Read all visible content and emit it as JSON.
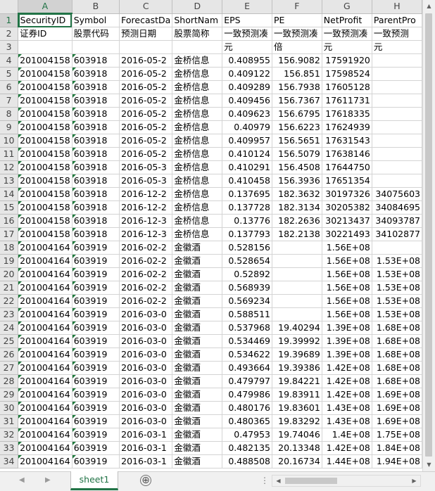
{
  "columns": [
    "A",
    "B",
    "C",
    "D",
    "E",
    "F",
    "G",
    "H"
  ],
  "active_column": "A",
  "active_row": 1,
  "rows": [
    {
      "n": "1",
      "cells": [
        "SecurityID",
        "Symbol",
        "ForecastDa",
        "ShortNam",
        "EPS",
        "PE",
        "NetProfit",
        "ParentPro"
      ]
    },
    {
      "n": "2",
      "cells": [
        "证券ID",
        "股票代码",
        "预测日期",
        "股票简称",
        "一致预测凑",
        "一致预测凑",
        "一致预测凑",
        "一致预测"
      ]
    },
    {
      "n": "3",
      "cells": [
        "",
        "",
        "",
        "",
        "元",
        "倍",
        "元",
        "元"
      ]
    },
    {
      "n": "4",
      "cells": [
        "201004158",
        "603918",
        "2016-05-2",
        "金桥信息",
        "0.408955",
        "156.9082",
        "17591920",
        ""
      ]
    },
    {
      "n": "5",
      "cells": [
        "201004158",
        "603918",
        "2016-05-2",
        "金桥信息",
        "0.409122",
        "156.851",
        "17598524",
        ""
      ]
    },
    {
      "n": "6",
      "cells": [
        "201004158",
        "603918",
        "2016-05-2",
        "金桥信息",
        "0.409289",
        "156.7938",
        "17605128",
        ""
      ]
    },
    {
      "n": "7",
      "cells": [
        "201004158",
        "603918",
        "2016-05-2",
        "金桥信息",
        "0.409456",
        "156.7367",
        "17611731",
        ""
      ]
    },
    {
      "n": "8",
      "cells": [
        "201004158",
        "603918",
        "2016-05-2",
        "金桥信息",
        "0.409623",
        "156.6795",
        "17618335",
        ""
      ]
    },
    {
      "n": "9",
      "cells": [
        "201004158",
        "603918",
        "2016-05-2",
        "金桥信息",
        "0.40979",
        "156.6223",
        "17624939",
        ""
      ]
    },
    {
      "n": "10",
      "cells": [
        "201004158",
        "603918",
        "2016-05-2",
        "金桥信息",
        "0.409957",
        "156.5651",
        "17631543",
        ""
      ]
    },
    {
      "n": "11",
      "cells": [
        "201004158",
        "603918",
        "2016-05-2",
        "金桥信息",
        "0.410124",
        "156.5079",
        "17638146",
        ""
      ]
    },
    {
      "n": "12",
      "cells": [
        "201004158",
        "603918",
        "2016-05-3",
        "金桥信息",
        "0.410291",
        "156.4508",
        "17644750",
        ""
      ]
    },
    {
      "n": "13",
      "cells": [
        "201004158",
        "603918",
        "2016-05-3",
        "金桥信息",
        "0.410458",
        "156.3936",
        "17651354",
        ""
      ]
    },
    {
      "n": "14",
      "cells": [
        "201004158",
        "603918",
        "2016-12-2",
        "金桥信息",
        "0.137695",
        "182.3632",
        "30197326",
        "34075603"
      ]
    },
    {
      "n": "15",
      "cells": [
        "201004158",
        "603918",
        "2016-12-2",
        "金桥信息",
        "0.137728",
        "182.3134",
        "30205382",
        "34084695"
      ]
    },
    {
      "n": "16",
      "cells": [
        "201004158",
        "603918",
        "2016-12-3",
        "金桥信息",
        "0.13776",
        "182.2636",
        "30213437",
        "34093787"
      ]
    },
    {
      "n": "17",
      "cells": [
        "201004158",
        "603918",
        "2016-12-3",
        "金桥信息",
        "0.137793",
        "182.2138",
        "30221493",
        "34102877"
      ]
    },
    {
      "n": "18",
      "cells": [
        "201004164",
        "603919",
        "2016-02-2",
        "金徽酒",
        "0.528156",
        "",
        "1.56E+08",
        ""
      ]
    },
    {
      "n": "19",
      "cells": [
        "201004164",
        "603919",
        "2016-02-2",
        "金徽酒",
        "0.528654",
        "",
        "1.56E+08",
        "1.53E+08"
      ]
    },
    {
      "n": "20",
      "cells": [
        "201004164",
        "603919",
        "2016-02-2",
        "金徽酒",
        "0.52892",
        "",
        "1.56E+08",
        "1.53E+08"
      ]
    },
    {
      "n": "21",
      "cells": [
        "201004164",
        "603919",
        "2016-02-2",
        "金徽酒",
        "0.568939",
        "",
        "1.56E+08",
        "1.53E+08"
      ]
    },
    {
      "n": "22",
      "cells": [
        "201004164",
        "603919",
        "2016-02-2",
        "金徽酒",
        "0.569234",
        "",
        "1.56E+08",
        "1.53E+08"
      ]
    },
    {
      "n": "23",
      "cells": [
        "201004164",
        "603919",
        "2016-03-0",
        "金徽酒",
        "0.588511",
        "",
        "1.56E+08",
        "1.53E+08"
      ]
    },
    {
      "n": "24",
      "cells": [
        "201004164",
        "603919",
        "2016-03-0",
        "金徽酒",
        "0.537968",
        "19.40294",
        "1.39E+08",
        "1.68E+08"
      ]
    },
    {
      "n": "25",
      "cells": [
        "201004164",
        "603919",
        "2016-03-0",
        "金徽酒",
        "0.534469",
        "19.39992",
        "1.39E+08",
        "1.68E+08"
      ]
    },
    {
      "n": "26",
      "cells": [
        "201004164",
        "603919",
        "2016-03-0",
        "金徽酒",
        "0.534622",
        "19.39689",
        "1.39E+08",
        "1.68E+08"
      ]
    },
    {
      "n": "27",
      "cells": [
        "201004164",
        "603919",
        "2016-03-0",
        "金徽酒",
        "0.493664",
        "19.39386",
        "1.42E+08",
        "1.68E+08"
      ]
    },
    {
      "n": "28",
      "cells": [
        "201004164",
        "603919",
        "2016-03-0",
        "金徽酒",
        "0.479797",
        "19.84221",
        "1.42E+08",
        "1.68E+08"
      ]
    },
    {
      "n": "29",
      "cells": [
        "201004164",
        "603919",
        "2016-03-0",
        "金徽酒",
        "0.479986",
        "19.83911",
        "1.42E+08",
        "1.69E+08"
      ]
    },
    {
      "n": "30",
      "cells": [
        "201004164",
        "603919",
        "2016-03-0",
        "金徽酒",
        "0.480176",
        "19.83601",
        "1.43E+08",
        "1.69E+08"
      ]
    },
    {
      "n": "31",
      "cells": [
        "201004164",
        "603919",
        "2016-03-0",
        "金徽酒",
        "0.480365",
        "19.83292",
        "1.43E+08",
        "1.69E+08"
      ]
    },
    {
      "n": "32",
      "cells": [
        "201004164",
        "603919",
        "2016-03-1",
        "金徽酒",
        "0.47953",
        "19.74046",
        "1.4E+08",
        "1.75E+08"
      ]
    },
    {
      "n": "33",
      "cells": [
        "201004164",
        "603919",
        "2016-03-1",
        "金徽酒",
        "0.482135",
        "20.13348",
        "1.42E+08",
        "1.84E+08"
      ]
    },
    {
      "n": "34",
      "cells": [
        "201004164",
        "603919",
        "2016-03-1",
        "金徽酒",
        "0.488508",
        "20.16734",
        "1.44E+08",
        "1.94E+08"
      ]
    }
  ],
  "sheet_tab": "sheet1",
  "add_sheet_symbol": "⊕",
  "colors": {
    "accent": "#217346",
    "header_bg": "#e6e6e6",
    "grid": "#d4d4d4",
    "flag": "#1e7a3c"
  }
}
